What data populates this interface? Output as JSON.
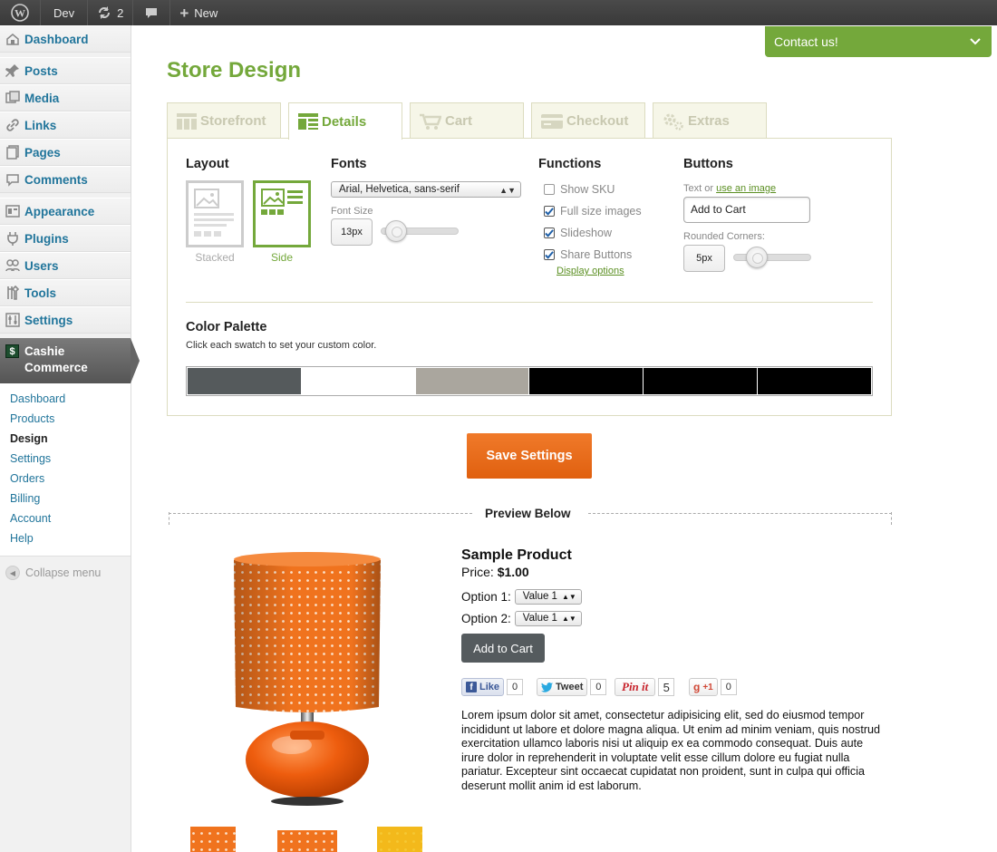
{
  "adminbar": {
    "site": "Dev",
    "updates": "2",
    "new_label": "New"
  },
  "sidebar": {
    "items": [
      {
        "label": "Dashboard",
        "icon": "dashboard-icon"
      },
      {
        "label": "Posts",
        "icon": "pin-icon"
      },
      {
        "label": "Media",
        "icon": "media-icon"
      },
      {
        "label": "Links",
        "icon": "link-icon"
      },
      {
        "label": "Pages",
        "icon": "pages-icon"
      },
      {
        "label": "Comments",
        "icon": "comment-icon"
      },
      {
        "label": "Appearance",
        "icon": "appearance-icon"
      },
      {
        "label": "Plugins",
        "icon": "plugin-icon"
      },
      {
        "label": "Users",
        "icon": "users-icon"
      },
      {
        "label": "Tools",
        "icon": "tools-icon"
      },
      {
        "label": "Settings",
        "icon": "settings-icon"
      }
    ],
    "cashie_line1": "Cashie",
    "cashie_line2": "Commerce",
    "submenu": [
      "Dashboard",
      "Products",
      "Design",
      "Settings",
      "Orders",
      "Billing",
      "Account",
      "Help"
    ],
    "current_submenu": "Design",
    "collapse": "Collapse menu"
  },
  "contact": "Contact us!",
  "page_title": "Store Design",
  "tabs": [
    {
      "label": "Storefront",
      "active": false
    },
    {
      "label": "Details",
      "active": true
    },
    {
      "label": "Cart",
      "active": false
    },
    {
      "label": "Checkout",
      "active": false
    },
    {
      "label": "Extras",
      "active": false
    }
  ],
  "layout": {
    "heading": "Layout",
    "options": [
      "Stacked",
      "Side"
    ],
    "selected": "Side"
  },
  "fonts": {
    "heading": "Fonts",
    "family": "Arial, Helvetica, sans-serif",
    "size_label": "Font Size",
    "size_value": "13px",
    "size_fraction": 0.2
  },
  "functions": {
    "heading": "Functions",
    "items": [
      {
        "label": "Show SKU",
        "checked": false
      },
      {
        "label": "Full size images",
        "checked": true
      },
      {
        "label": "Slideshow",
        "checked": true
      },
      {
        "label": "Share Buttons",
        "checked": true
      }
    ],
    "display_options": "Display options"
  },
  "buttons": {
    "heading": "Buttons",
    "text_or": "Text or",
    "use_image": "use an image",
    "button_text": "Add to Cart",
    "corners_label": "Rounded Corners:",
    "corners_value": "5px",
    "corners_fraction": 0.3
  },
  "palette": {
    "heading": "Color Palette",
    "hint": "Click each swatch to set your custom color.",
    "swatches": [
      "#555a5c",
      "#ffffff",
      "#aaa69e",
      "#000000",
      "#000000",
      "#000000"
    ]
  },
  "save_label": "Save Settings",
  "preview_label": "Preview Below",
  "product": {
    "name": "Sample Product",
    "price_label": "Price:",
    "price": "$1.00",
    "options": [
      {
        "label": "Option 1:",
        "value": "Value 1"
      },
      {
        "label": "Option 2:",
        "value": "Value 1"
      }
    ],
    "add_to_cart": "Add to Cart",
    "share": {
      "like": "Like",
      "like_count": "0",
      "tweet": "Tweet",
      "tweet_count": "0",
      "pin": "Pin it",
      "pin_count": "5",
      "plus": "+1",
      "plus_count": "0"
    },
    "description": "Lorem ipsum dolor sit amet, consectetur adipisicing elit, sed do eiusmod tempor incididunt ut labore et dolore magna aliqua. Ut enim ad minim veniam, quis nostrud exercitation ullamco laboris nisi ut aliquip ex ea commodo consequat. Duis aute irure dolor in reprehenderit in voluptate velit esse cillum dolore eu fugiat nulla pariatur. Excepteur sint occaecat cupidatat non proident, sunt in culpa qui officia deserunt mollit anim id est laborum."
  },
  "colors": {
    "brand_green": "#74a83b",
    "save_orange": "#e8671b",
    "wp_link": "#21759b"
  }
}
